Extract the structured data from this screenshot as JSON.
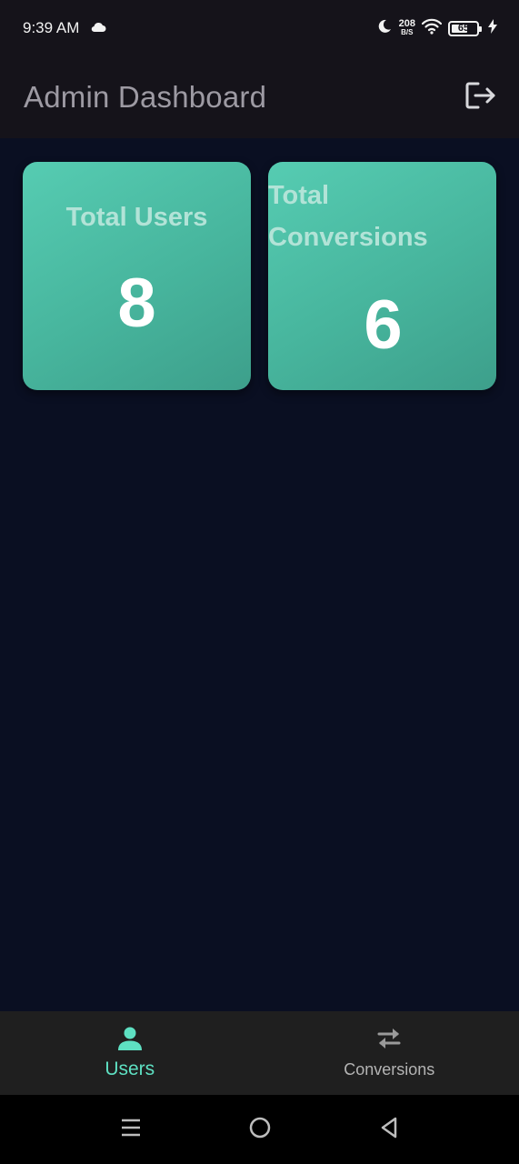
{
  "status_bar": {
    "time": "9:39 AM",
    "net_speed_value": "208",
    "net_speed_unit": "B/S",
    "battery_level": "65",
    "battery_fraction": 0.65
  },
  "app_bar": {
    "title": "Admin Dashboard",
    "logout_icon": "logout-icon"
  },
  "stats": {
    "total_users_label": "Total Users",
    "total_users_value": "8",
    "total_conversions_label": "Total Conversions",
    "total_conversions_value": "6"
  },
  "bottom_nav": {
    "items": [
      {
        "label": "Users",
        "icon": "person-icon",
        "active": true
      },
      {
        "label": "Conversions",
        "icon": "swap-arrows-icon",
        "active": false
      }
    ]
  },
  "system_nav": {
    "recents": "menu-icon",
    "home": "home-circle-icon",
    "back": "back-triangle-icon"
  },
  "colors": {
    "accent": "#5ee0c2",
    "card_gradient_start": "#56ccb2",
    "card_gradient_end": "#3d9f8b",
    "background": "#0a0f22",
    "app_bar": "#15131a"
  }
}
